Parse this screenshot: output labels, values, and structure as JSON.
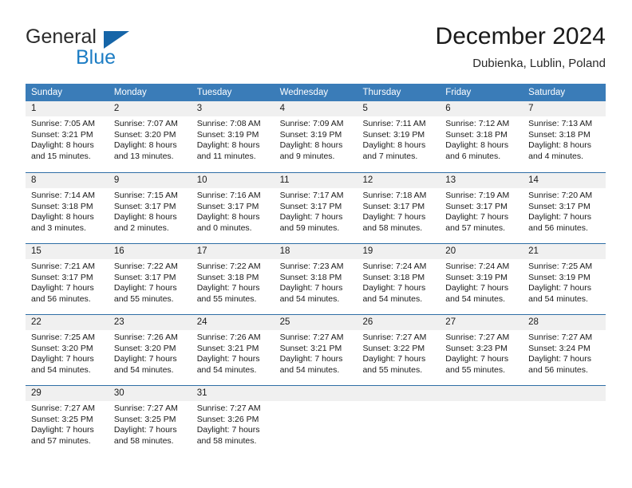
{
  "brand": {
    "name_part1": "General",
    "name_part2": "Blue",
    "logo_icon": "blue-triangle-logo",
    "accent_color": "#1d7dc4"
  },
  "header": {
    "title": "December 2024",
    "location": "Dubienka, Lublin, Poland"
  },
  "theme": {
    "header_row_bg": "#3a7cb8",
    "week_divider": "#2f6ea5",
    "date_band_bg": "#f0f0f0",
    "text_color": "#1a1a1a"
  },
  "calendar": {
    "weekday_headers": [
      "Sunday",
      "Monday",
      "Tuesday",
      "Wednesday",
      "Thursday",
      "Friday",
      "Saturday"
    ],
    "weeks": [
      [
        {
          "day": "1",
          "lines": [
            "Sunrise: 7:05 AM",
            "Sunset: 3:21 PM",
            "Daylight: 8 hours",
            "and 15 minutes."
          ]
        },
        {
          "day": "2",
          "lines": [
            "Sunrise: 7:07 AM",
            "Sunset: 3:20 PM",
            "Daylight: 8 hours",
            "and 13 minutes."
          ]
        },
        {
          "day": "3",
          "lines": [
            "Sunrise: 7:08 AM",
            "Sunset: 3:19 PM",
            "Daylight: 8 hours",
            "and 11 minutes."
          ]
        },
        {
          "day": "4",
          "lines": [
            "Sunrise: 7:09 AM",
            "Sunset: 3:19 PM",
            "Daylight: 8 hours",
            "and 9 minutes."
          ]
        },
        {
          "day": "5",
          "lines": [
            "Sunrise: 7:11 AM",
            "Sunset: 3:19 PM",
            "Daylight: 8 hours",
            "and 7 minutes."
          ]
        },
        {
          "day": "6",
          "lines": [
            "Sunrise: 7:12 AM",
            "Sunset: 3:18 PM",
            "Daylight: 8 hours",
            "and 6 minutes."
          ]
        },
        {
          "day": "7",
          "lines": [
            "Sunrise: 7:13 AM",
            "Sunset: 3:18 PM",
            "Daylight: 8 hours",
            "and 4 minutes."
          ]
        }
      ],
      [
        {
          "day": "8",
          "lines": [
            "Sunrise: 7:14 AM",
            "Sunset: 3:18 PM",
            "Daylight: 8 hours",
            "and 3 minutes."
          ]
        },
        {
          "day": "9",
          "lines": [
            "Sunrise: 7:15 AM",
            "Sunset: 3:17 PM",
            "Daylight: 8 hours",
            "and 2 minutes."
          ]
        },
        {
          "day": "10",
          "lines": [
            "Sunrise: 7:16 AM",
            "Sunset: 3:17 PM",
            "Daylight: 8 hours",
            "and 0 minutes."
          ]
        },
        {
          "day": "11",
          "lines": [
            "Sunrise: 7:17 AM",
            "Sunset: 3:17 PM",
            "Daylight: 7 hours",
            "and 59 minutes."
          ]
        },
        {
          "day": "12",
          "lines": [
            "Sunrise: 7:18 AM",
            "Sunset: 3:17 PM",
            "Daylight: 7 hours",
            "and 58 minutes."
          ]
        },
        {
          "day": "13",
          "lines": [
            "Sunrise: 7:19 AM",
            "Sunset: 3:17 PM",
            "Daylight: 7 hours",
            "and 57 minutes."
          ]
        },
        {
          "day": "14",
          "lines": [
            "Sunrise: 7:20 AM",
            "Sunset: 3:17 PM",
            "Daylight: 7 hours",
            "and 56 minutes."
          ]
        }
      ],
      [
        {
          "day": "15",
          "lines": [
            "Sunrise: 7:21 AM",
            "Sunset: 3:17 PM",
            "Daylight: 7 hours",
            "and 56 minutes."
          ]
        },
        {
          "day": "16",
          "lines": [
            "Sunrise: 7:22 AM",
            "Sunset: 3:17 PM",
            "Daylight: 7 hours",
            "and 55 minutes."
          ]
        },
        {
          "day": "17",
          "lines": [
            "Sunrise: 7:22 AM",
            "Sunset: 3:18 PM",
            "Daylight: 7 hours",
            "and 55 minutes."
          ]
        },
        {
          "day": "18",
          "lines": [
            "Sunrise: 7:23 AM",
            "Sunset: 3:18 PM",
            "Daylight: 7 hours",
            "and 54 minutes."
          ]
        },
        {
          "day": "19",
          "lines": [
            "Sunrise: 7:24 AM",
            "Sunset: 3:18 PM",
            "Daylight: 7 hours",
            "and 54 minutes."
          ]
        },
        {
          "day": "20",
          "lines": [
            "Sunrise: 7:24 AM",
            "Sunset: 3:19 PM",
            "Daylight: 7 hours",
            "and 54 minutes."
          ]
        },
        {
          "day": "21",
          "lines": [
            "Sunrise: 7:25 AM",
            "Sunset: 3:19 PM",
            "Daylight: 7 hours",
            "and 54 minutes."
          ]
        }
      ],
      [
        {
          "day": "22",
          "lines": [
            "Sunrise: 7:25 AM",
            "Sunset: 3:20 PM",
            "Daylight: 7 hours",
            "and 54 minutes."
          ]
        },
        {
          "day": "23",
          "lines": [
            "Sunrise: 7:26 AM",
            "Sunset: 3:20 PM",
            "Daylight: 7 hours",
            "and 54 minutes."
          ]
        },
        {
          "day": "24",
          "lines": [
            "Sunrise: 7:26 AM",
            "Sunset: 3:21 PM",
            "Daylight: 7 hours",
            "and 54 minutes."
          ]
        },
        {
          "day": "25",
          "lines": [
            "Sunrise: 7:27 AM",
            "Sunset: 3:21 PM",
            "Daylight: 7 hours",
            "and 54 minutes."
          ]
        },
        {
          "day": "26",
          "lines": [
            "Sunrise: 7:27 AM",
            "Sunset: 3:22 PM",
            "Daylight: 7 hours",
            "and 55 minutes."
          ]
        },
        {
          "day": "27",
          "lines": [
            "Sunrise: 7:27 AM",
            "Sunset: 3:23 PM",
            "Daylight: 7 hours",
            "and 55 minutes."
          ]
        },
        {
          "day": "28",
          "lines": [
            "Sunrise: 7:27 AM",
            "Sunset: 3:24 PM",
            "Daylight: 7 hours",
            "and 56 minutes."
          ]
        }
      ],
      [
        {
          "day": "29",
          "lines": [
            "Sunrise: 7:27 AM",
            "Sunset: 3:25 PM",
            "Daylight: 7 hours",
            "and 57 minutes."
          ]
        },
        {
          "day": "30",
          "lines": [
            "Sunrise: 7:27 AM",
            "Sunset: 3:25 PM",
            "Daylight: 7 hours",
            "and 58 minutes."
          ]
        },
        {
          "day": "31",
          "lines": [
            "Sunrise: 7:27 AM",
            "Sunset: 3:26 PM",
            "Daylight: 7 hours",
            "and 58 minutes."
          ]
        },
        {
          "day": "",
          "lines": []
        },
        {
          "day": "",
          "lines": []
        },
        {
          "day": "",
          "lines": []
        },
        {
          "day": "",
          "lines": []
        }
      ]
    ]
  }
}
